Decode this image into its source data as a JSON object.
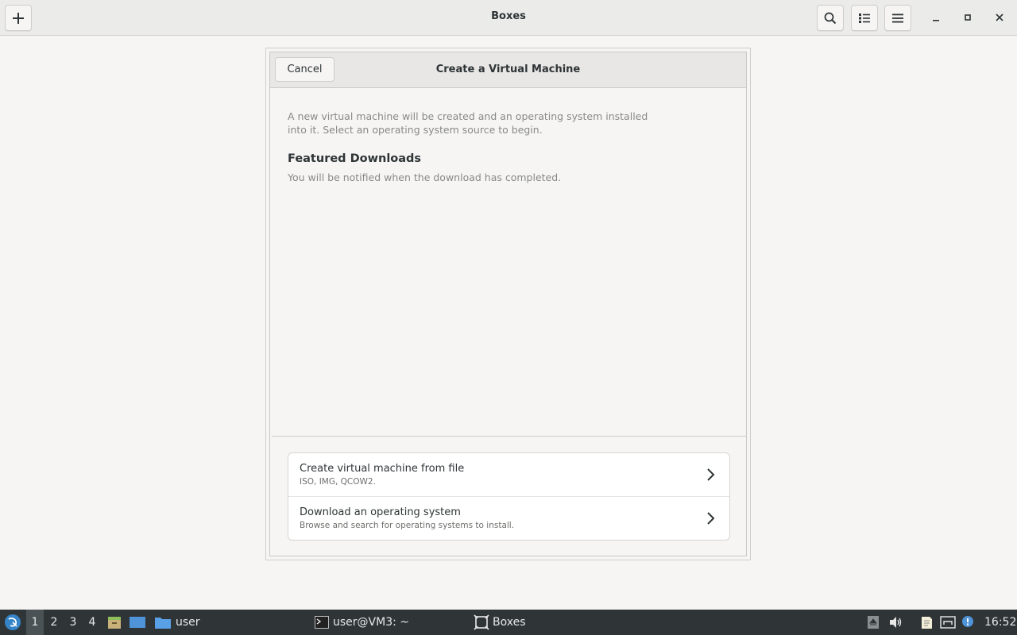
{
  "header": {
    "title": "Boxes",
    "add_icon": "plus-icon",
    "search_icon": "search-icon",
    "view_icon": "list-view-icon",
    "menu_icon": "hamburger-menu-icon"
  },
  "dialog": {
    "cancel_label": "Cancel",
    "title": "Create a Virtual Machine",
    "intro_line1": "A new virtual machine will be created and an operating system installed",
    "intro_line2": "into it. Select an operating system source to begin.",
    "featured_heading": "Featured Downloads",
    "featured_sub": "You will be notified when the download has completed.",
    "options": [
      {
        "title": "Create virtual machine from file",
        "subtitle": "ISO, IMG, QCOW2."
      },
      {
        "title": "Download an operating system",
        "subtitle": "Browse and search for operating systems to install."
      }
    ]
  },
  "taskbar": {
    "workspaces": [
      "1",
      "2",
      "3",
      "4"
    ],
    "active_workspace": "1",
    "folder_label": "user",
    "terminal_label": "user@VM3: ~",
    "boxes_label": "Boxes",
    "clock": "16:52"
  }
}
